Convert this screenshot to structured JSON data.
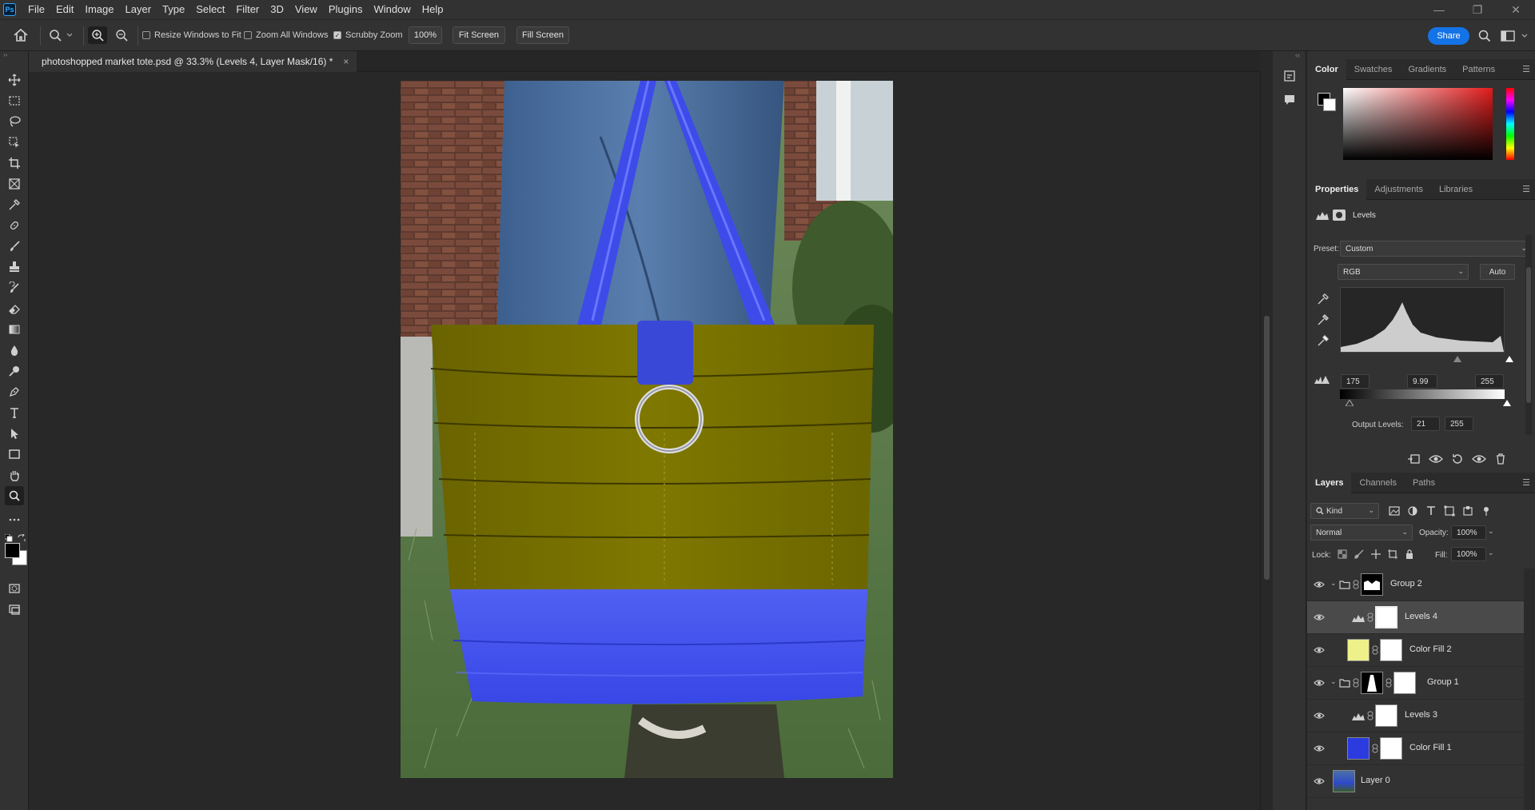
{
  "app": {
    "logo": "Ps"
  },
  "menubar": {
    "items": [
      "File",
      "Edit",
      "Image",
      "Layer",
      "Type",
      "Select",
      "Filter",
      "3D",
      "View",
      "Plugins",
      "Window",
      "Help"
    ]
  },
  "window_controls": {
    "minimize": "—",
    "restore": "❐",
    "close": "✕"
  },
  "options": {
    "resize_windows": "Resize Windows to Fit",
    "zoom_all": "Zoom All Windows",
    "scrubby_zoom": "Scrubby Zoom",
    "zoom_value": "100%",
    "fit_screen": "Fit Screen",
    "fill_screen": "Fill Screen",
    "share": "Share",
    "checks": {
      "resize_windows": false,
      "zoom_all": false,
      "scrubby_zoom": true
    }
  },
  "document": {
    "tab_title": "photoshopped  market tote.psd @ 33.3% (Levels 4, Layer Mask/16) *",
    "close": "×"
  },
  "color_panel": {
    "tabs": [
      "Color",
      "Swatches",
      "Gradients",
      "Patterns"
    ],
    "active_tab": "Color"
  },
  "properties_panel": {
    "tabs": [
      "Properties",
      "Adjustments",
      "Libraries"
    ],
    "title": "Levels",
    "preset_label": "Preset:",
    "preset_value": "Custom",
    "channel": "RGB",
    "auto": "Auto",
    "input_black": "175",
    "input_gamma": "9.99",
    "input_white": "255",
    "output_label": "Output Levels:",
    "output_black": "21",
    "output_white": "255"
  },
  "layers_panel": {
    "tabs": [
      "Layers",
      "Channels",
      "Paths"
    ],
    "filter_kind": "Kind",
    "blend_mode": "Normal",
    "opacity_label": "Opacity:",
    "opacity_value": "100%",
    "lock_label": "Lock:",
    "fill_label": "Fill:",
    "fill_value": "100%",
    "layers": [
      {
        "name": "Group 2",
        "type": "group"
      },
      {
        "name": "Levels 4",
        "type": "levels",
        "selected": true
      },
      {
        "name": "Color Fill 2",
        "type": "fill",
        "color": "#eef08a"
      },
      {
        "name": "Group 1",
        "type": "group"
      },
      {
        "name": "Levels 3",
        "type": "levels"
      },
      {
        "name": "Color Fill 1",
        "type": "fill",
        "color": "#2b3be0"
      },
      {
        "name": "Layer 0",
        "type": "pixel"
      }
    ]
  },
  "colors": {
    "accent": "#1473e6",
    "bg": "#282828",
    "panel": "#323232",
    "tote_top": "#756f00",
    "tote_bottom": "#4456ee"
  }
}
